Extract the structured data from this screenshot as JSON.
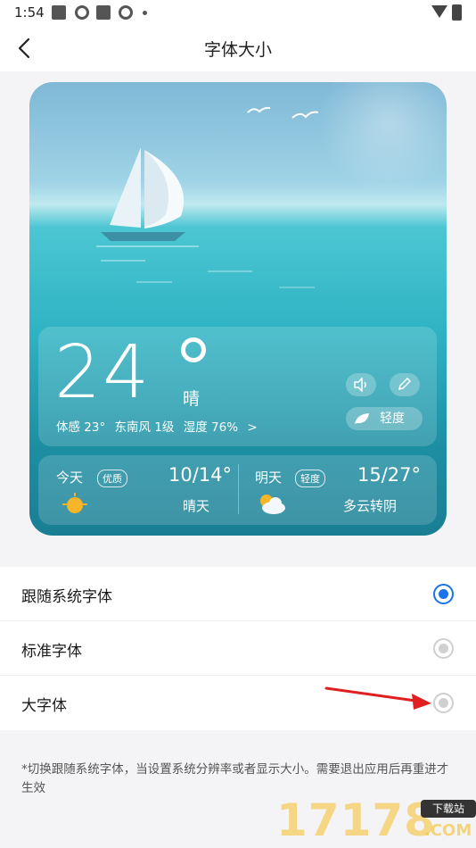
{
  "status": {
    "time": "1:54"
  },
  "header": {
    "title": "字体大小"
  },
  "weather": {
    "temperature": "24",
    "condition": "晴",
    "feels_like": "体感 23°",
    "wind": "东南风 1级",
    "humidity": "湿度 76%",
    "more": ">",
    "aqi_label": "轻度",
    "forecast": [
      {
        "day": "今天",
        "badge": "优质",
        "temp": "10/14°",
        "condition": "晴天"
      },
      {
        "day": "明天",
        "badge": "轻度",
        "temp": "15/27°",
        "condition": "多云转阴"
      }
    ]
  },
  "options": [
    {
      "label": "跟随系统字体",
      "selected": true
    },
    {
      "label": "标准字体",
      "selected": false
    },
    {
      "label": "大字体",
      "selected": false
    }
  ],
  "note": "*切换跟随系统字体，当设置系统分辨率或者显示大小。需要退出应用后再重进才生效",
  "watermark": {
    "number": "17178",
    "tag": "下载站",
    "suffix": ".COM"
  },
  "colors": {
    "accent": "#1a73e8",
    "arrow": "#e02020"
  }
}
